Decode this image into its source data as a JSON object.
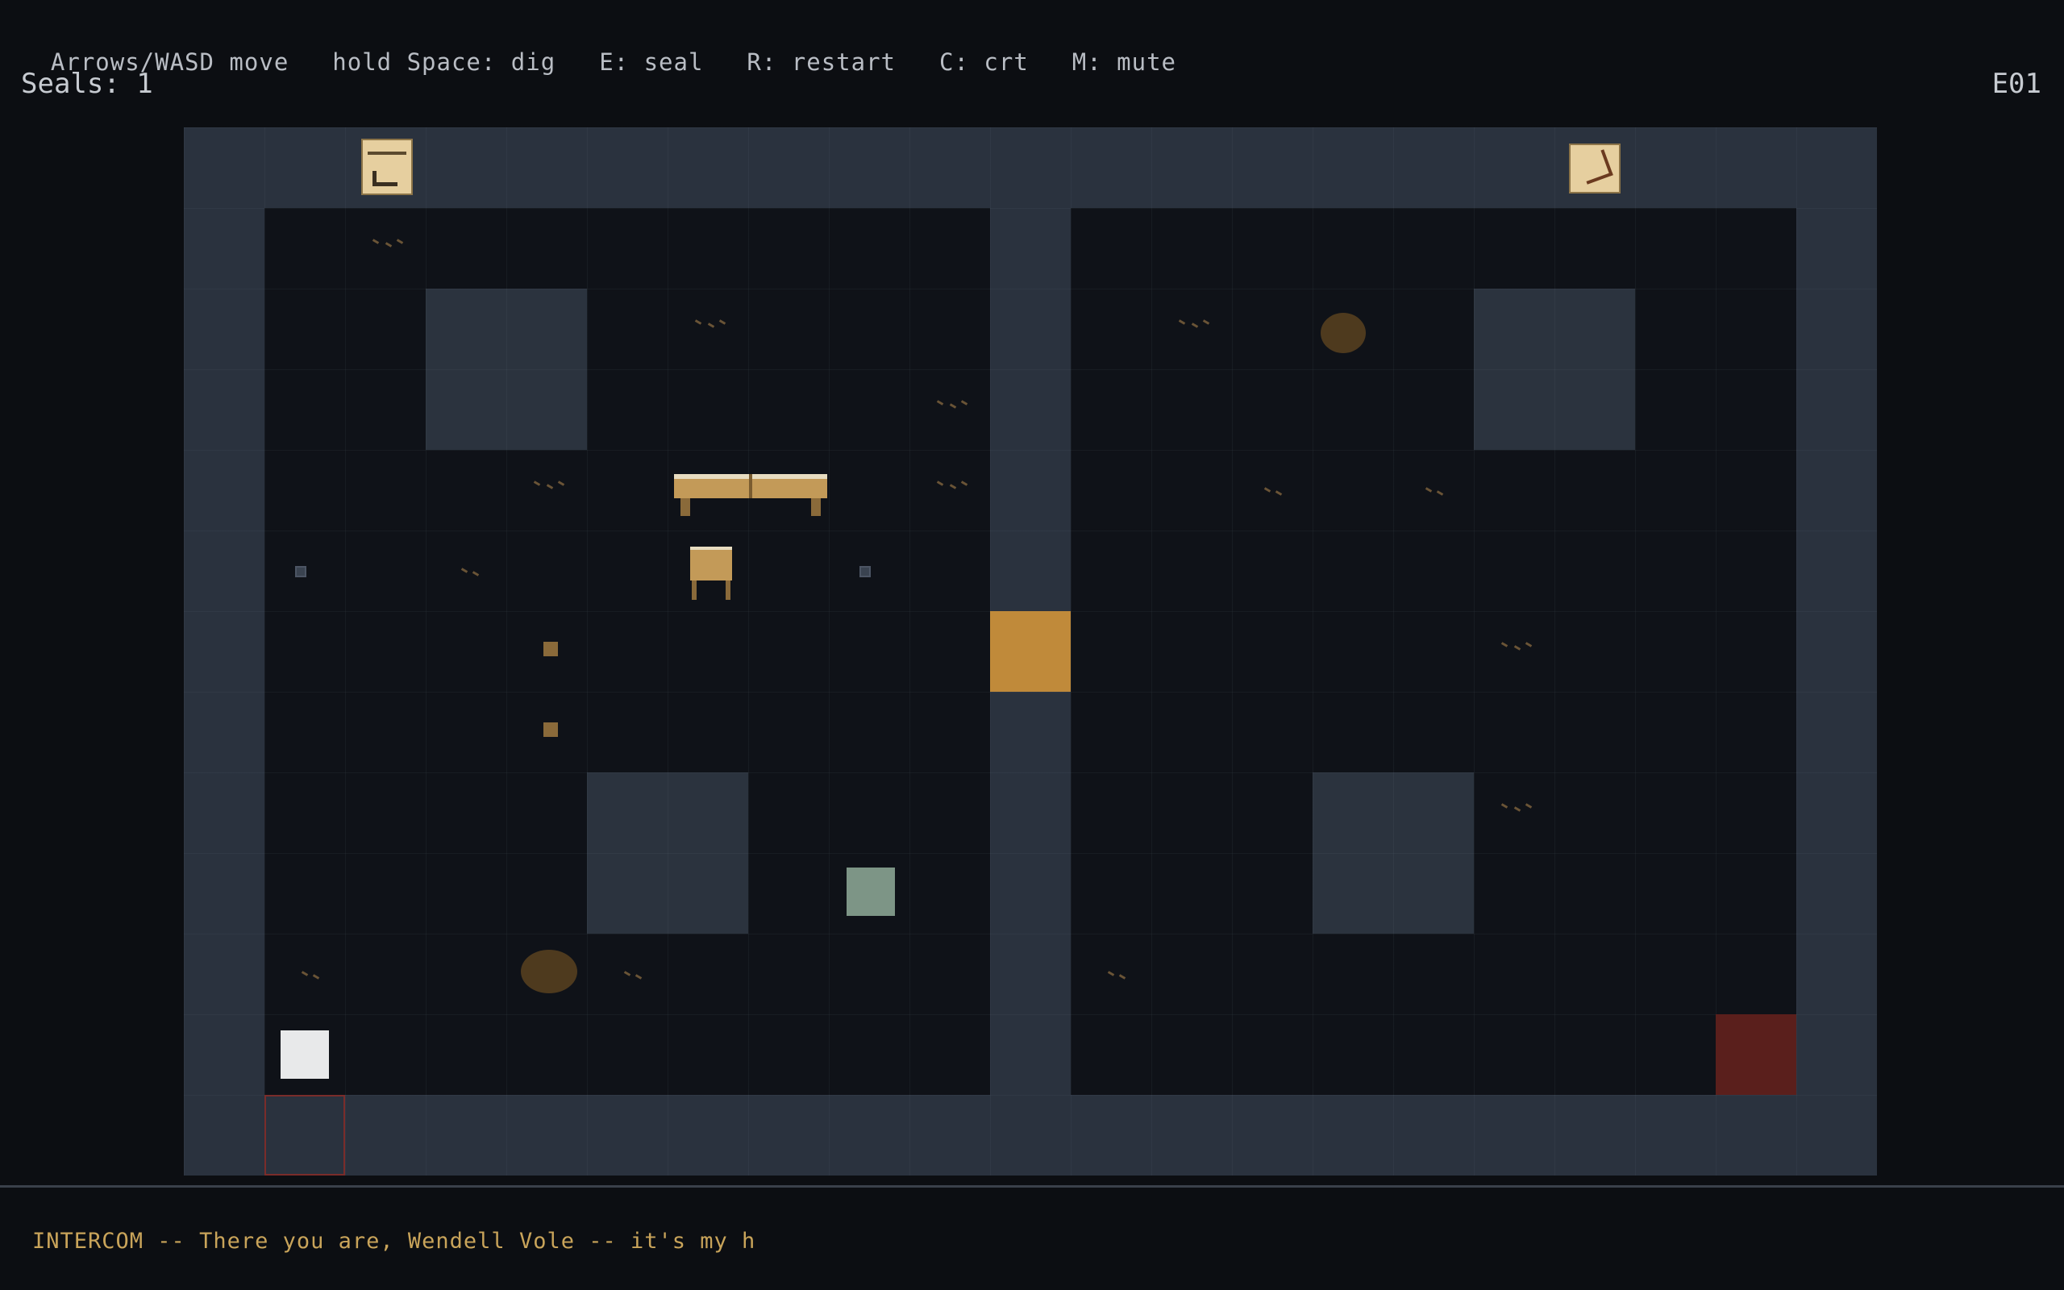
{
  "hud": {
    "controls": [
      "Arrows/WASD move",
      "hold Space: dig",
      "E: seal",
      "R: restart",
      "C: crt",
      "M: mute"
    ],
    "seals_label": "Seals: 1",
    "level": "E01"
  },
  "dialog": {
    "text": "INTERCOM -- There you are, Wendell Vole -- it's my h"
  },
  "colors": {
    "background": "#0c0e12",
    "wall": "#2a323e",
    "floor": "#0f1218",
    "door": "#c08a3a",
    "exit": "#5a1f1c",
    "player": "#e8e9ea",
    "intercom_text": "#c9a45a"
  }
}
